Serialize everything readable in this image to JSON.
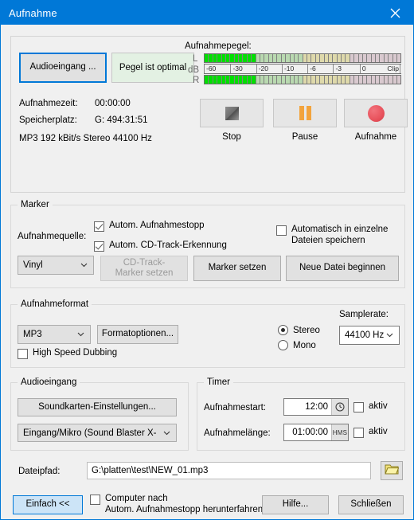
{
  "window": {
    "title": "Aufnahme",
    "close_icon": "close-icon"
  },
  "recording_panel": {
    "audio_input_button": "Audioeingang ...",
    "level_status": "Pegel ist optimal",
    "level_meter": {
      "caption": "Aufnahmepegel:",
      "left_label": "L",
      "right_label": "R",
      "db_label": "dB",
      "ticks": [
        "-60",
        "-30",
        "-20",
        "-10",
        "-6",
        "-3",
        "0",
        "Clip"
      ],
      "left_level_percent": 27,
      "right_level_percent": 27,
      "segments_total": 46
    },
    "status": {
      "time_label": "Aufnahmezeit:",
      "time_value": "00:00:00",
      "space_label": "Speicherplatz:",
      "space_value": "G: 494:31:51",
      "format_line": "MP3 192 kBit/s Stereo 44100 Hz"
    },
    "transport": {
      "stop_label": "Stop",
      "pause_label": "Pause",
      "record_label": "Aufnahme",
      "stop_icon": "stop-square-icon",
      "pause_icon": "pause-bars-icon",
      "record_icon": "record-circle-icon",
      "record_color": "#e8525c",
      "pause_color": "#f2a33c"
    }
  },
  "marker_group": {
    "legend": "Marker",
    "source_label": "Aufnahmequelle:",
    "source_value": "Vinyl",
    "checkbox_autostop": {
      "label": "Autom. Aufnahmestopp",
      "checked": true
    },
    "checkbox_cdtrack": {
      "label": "Autom. CD-Track-Erkennung",
      "checked": true
    },
    "checkbox_separate_files": {
      "label_line1": "Automatisch in einzelne",
      "label_line2": "Dateien speichern",
      "checked": false
    },
    "cd_track_marker_button_line1": "CD-Track-",
    "cd_track_marker_button_line2": "Marker setzen",
    "set_marker_button": "Marker setzen",
    "new_file_button": "Neue Datei beginnen"
  },
  "format_group": {
    "legend": "Aufnahmeformat",
    "format_value": "MP3",
    "format_options_button": "Formatoptionen...",
    "high_speed_dubbing": {
      "label": "High Speed Dubbing",
      "checked": false
    },
    "stereo_radio": {
      "label": "Stereo",
      "selected": true
    },
    "mono_radio": {
      "label": "Mono",
      "selected": false
    },
    "samplerate_label": "Samplerate:",
    "samplerate_value": "44100 Hz"
  },
  "audio_input_group": {
    "legend": "Audioeingang",
    "soundcard_button": "Soundkarten-Einstellungen...",
    "device_value": "Eingang/Mikro (Sound Blaster X-"
  },
  "timer_group": {
    "legend": "Timer",
    "start_label": "Aufnahmestart:",
    "start_value": "12:00",
    "start_unit_icon": "clock-icon",
    "start_active": {
      "label": "aktiv",
      "checked": false
    },
    "length_label": "Aufnahmelänge:",
    "length_value": "01:00:00",
    "length_unit": "HMS",
    "length_active": {
      "label": "aktiv",
      "checked": false
    }
  },
  "file_path": {
    "label": "Dateipfad:",
    "value": "G:\\platten\\test\\NEW_01.mp3",
    "browse_icon": "folder-icon"
  },
  "footer": {
    "simple_button": "Einfach <<",
    "shutdown_checkbox": {
      "label_line1": "Computer nach",
      "label_line2": "Autom. Aufnahmestopp herunterfahren",
      "checked": false
    },
    "help_button": "Hilfe...",
    "close_button": "Schließen"
  }
}
